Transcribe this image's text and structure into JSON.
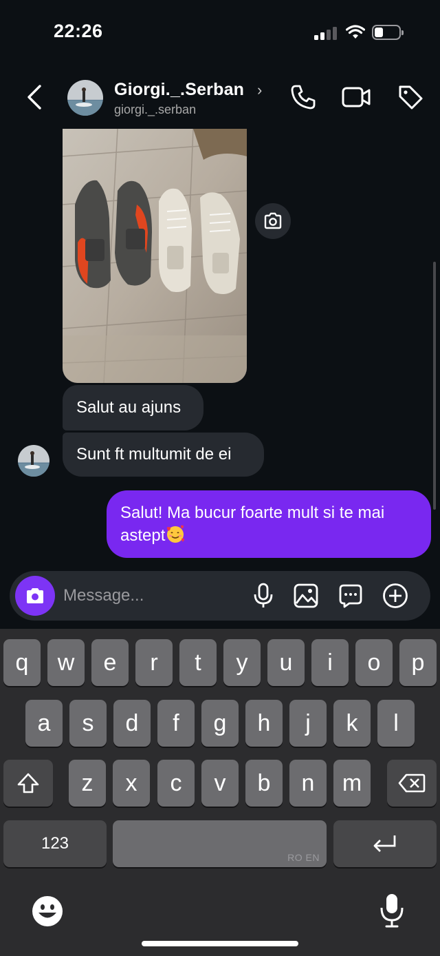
{
  "status_bar": {
    "time": "22:26"
  },
  "header": {
    "display_name": "Giorgi._.Serban",
    "chevron": "›",
    "username": "giorgi._.serban",
    "icons": [
      "back-arrow-icon",
      "phone-icon",
      "video-camera-icon",
      "tag-icon"
    ]
  },
  "messages": [
    {
      "from": "them",
      "type": "photo",
      "content": "photo of two pairs of sneakers"
    },
    {
      "from": "them",
      "type": "text",
      "text": "Salut au ajuns"
    },
    {
      "from": "them",
      "type": "text",
      "text": "Sunt ft multumit de ei"
    },
    {
      "from": "me",
      "type": "text",
      "text": "Salut! Ma bucur foarte mult si te mai astept",
      "emoji": "smiling-face-with-hearts"
    }
  ],
  "composer": {
    "placeholder": "Message...",
    "icons": [
      "camera-icon",
      "microphone-icon",
      "gallery-icon",
      "sticker-icon",
      "plus-icon"
    ]
  },
  "keyboard": {
    "row1": [
      "q",
      "w",
      "e",
      "r",
      "t",
      "y",
      "u",
      "i",
      "o",
      "p"
    ],
    "row2": [
      "a",
      "s",
      "d",
      "f",
      "g",
      "h",
      "j",
      "k",
      "l"
    ],
    "row3": [
      "z",
      "x",
      "c",
      "v",
      "b",
      "n",
      "m"
    ],
    "numbers_label": "123",
    "languages": "RO EN"
  },
  "colors": {
    "accent": "#7928f0",
    "incoming_bubble": "#262a30",
    "background": "#0c1014"
  }
}
